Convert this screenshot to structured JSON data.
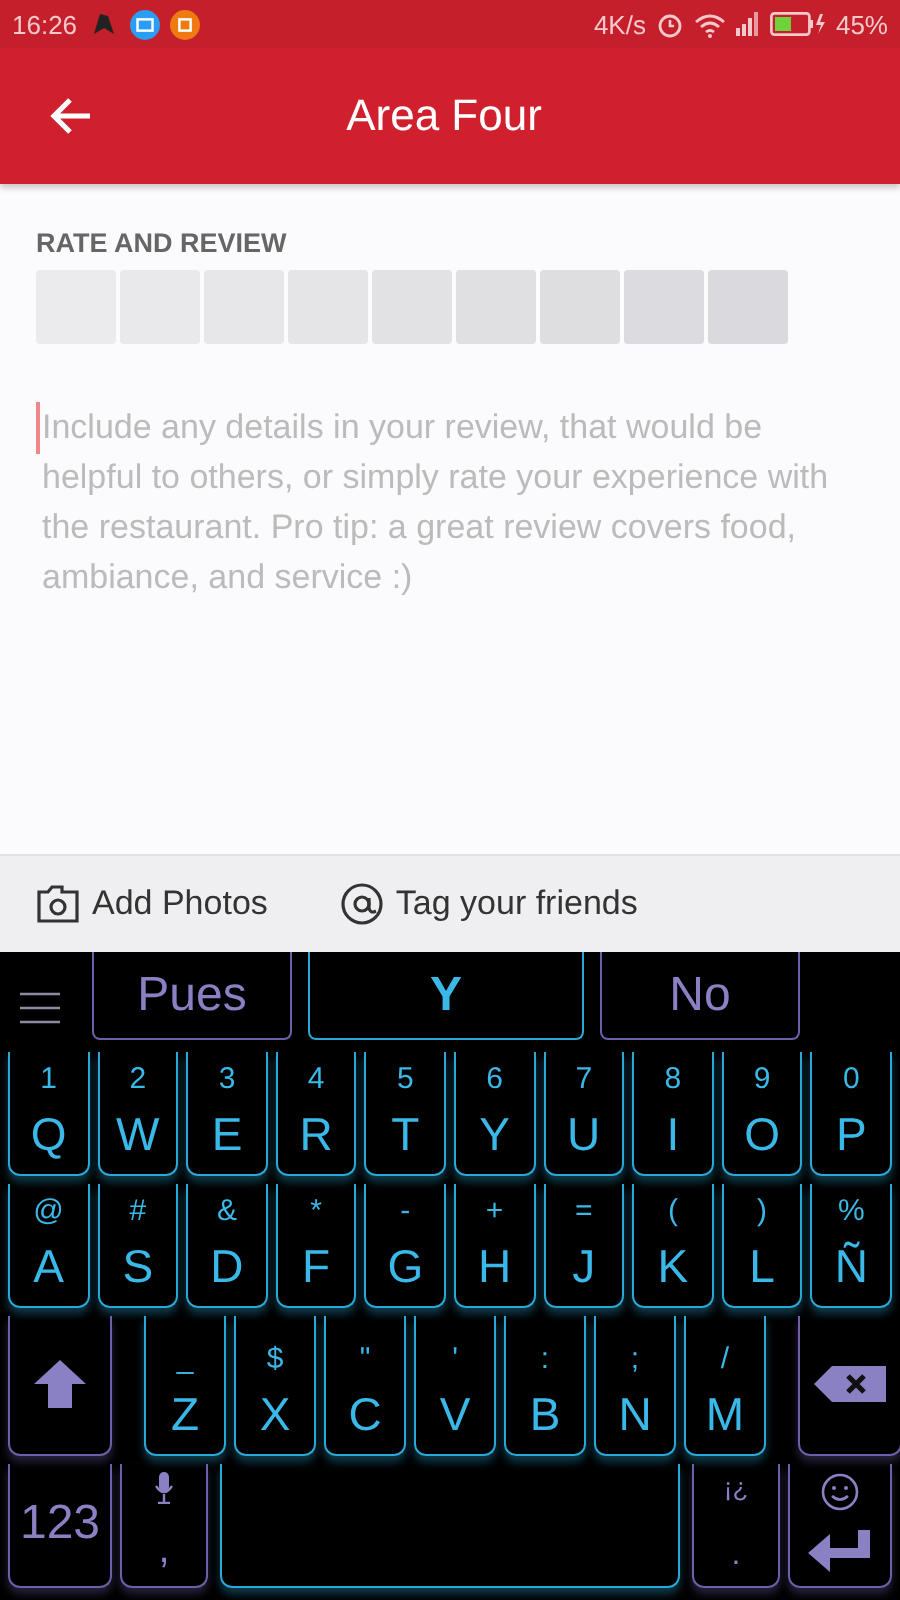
{
  "status_bar": {
    "time": "16:26",
    "speed": "4K/s",
    "battery": "45%"
  },
  "app_bar": {
    "title": "Area Four"
  },
  "rating": {
    "label": "RATE AND REVIEW",
    "stars": 0
  },
  "review": {
    "placeholder": "Include any details in your review, that would be helpful to others, or simply rate your experience with the restaurant. Pro tip: a great review covers food, ambiance, and service :)"
  },
  "actions": [
    {
      "kind": "photo",
      "label": "Add Photos"
    },
    {
      "kind": "tag",
      "label": "Tag your friends"
    }
  ],
  "keyboard": {
    "suggestions": [
      {
        "text": "Pues",
        "selected": false
      },
      {
        "text": "Y",
        "selected": true
      },
      {
        "text": "No",
        "selected": false
      }
    ],
    "rows": [
      [
        {
          "kind": "letter",
          "hint": "1",
          "label": "Q"
        },
        {
          "kind": "letter",
          "hint": "2",
          "label": "W"
        },
        {
          "kind": "letter",
          "hint": "3",
          "label": "E"
        },
        {
          "kind": "letter",
          "hint": "4",
          "label": "R"
        },
        {
          "kind": "letter",
          "hint": "5",
          "label": "T"
        },
        {
          "kind": "letter",
          "hint": "6",
          "label": "Y"
        },
        {
          "kind": "letter",
          "hint": "7",
          "label": "U"
        },
        {
          "kind": "letter",
          "hint": "8",
          "label": "I"
        },
        {
          "kind": "letter",
          "hint": "9",
          "label": "O"
        },
        {
          "kind": "letter",
          "hint": "0",
          "label": "P"
        }
      ],
      [
        {
          "kind": "letter",
          "hint": "@",
          "label": "A"
        },
        {
          "kind": "letter",
          "hint": "#",
          "label": "S"
        },
        {
          "kind": "letter",
          "hint": "&",
          "label": "D"
        },
        {
          "kind": "letter",
          "hint": "*",
          "label": "F"
        },
        {
          "kind": "letter",
          "hint": "-",
          "label": "G"
        },
        {
          "kind": "letter",
          "hint": "+",
          "label": "H"
        },
        {
          "kind": "letter",
          "hint": "=",
          "label": "J"
        },
        {
          "kind": "letter",
          "hint": "(",
          "label": "K"
        },
        {
          "kind": "letter",
          "hint": ")",
          "label": "L"
        },
        {
          "kind": "letter",
          "hint": "%",
          "label": "Ñ"
        }
      ],
      [
        {
          "kind": "shift"
        },
        {
          "kind": "letter",
          "hint": "_",
          "label": "Z"
        },
        {
          "kind": "letter",
          "hint": "$",
          "label": "X"
        },
        {
          "kind": "letter",
          "hint": "\"",
          "label": "C"
        },
        {
          "kind": "letter",
          "hint": "'",
          "label": "V"
        },
        {
          "kind": "letter",
          "hint": ":",
          "label": "B"
        },
        {
          "kind": "letter",
          "hint": ";",
          "label": "N"
        },
        {
          "kind": "letter",
          "hint": "/",
          "label": "M"
        },
        {
          "kind": "backspace"
        }
      ],
      [
        {
          "kind": "mode",
          "label": "123"
        },
        {
          "kind": "mic",
          "label": ","
        },
        {
          "kind": "space"
        },
        {
          "kind": "punct",
          "hint": "¡¿",
          "label": "."
        },
        {
          "kind": "enter"
        }
      ]
    ]
  }
}
